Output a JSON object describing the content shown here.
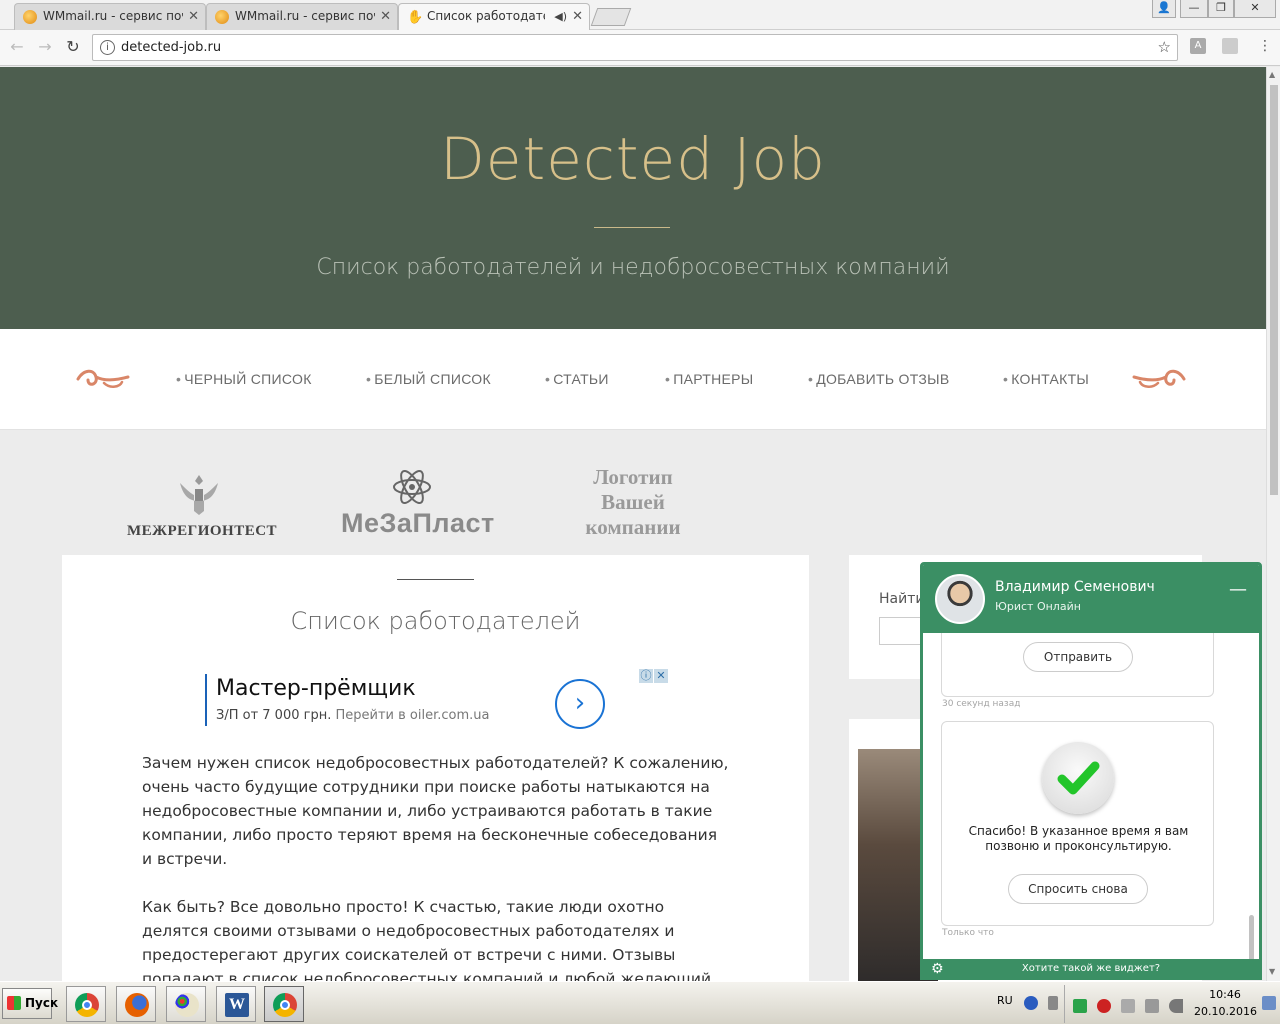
{
  "browser": {
    "tabs": [
      {
        "title": "WMmail.ru - сервис почтов",
        "active": false
      },
      {
        "title": "WMmail.ru - сервис почтов",
        "active": false
      },
      {
        "title": "Список работодателей",
        "active": true
      }
    ],
    "url": "detected-job.ru"
  },
  "hero": {
    "title": "Detected Job",
    "tagline": "Список работодателей и недобросовестных компаний"
  },
  "nav": {
    "items": [
      {
        "label": "ЧЕРНЫЙ СПИСОК"
      },
      {
        "label": "БЕЛЫЙ СПИСОК"
      },
      {
        "label": "СТАТЬИ"
      },
      {
        "label": "ПАРТНЕРЫ"
      },
      {
        "label": "ДОБАВИТЬ ОТЗЫВ"
      },
      {
        "label": "КОНТАКТЫ"
      }
    ]
  },
  "partners": {
    "logo1": "МЕЖРЕГИОНТЕСТ",
    "logo2": "МеЗаПласт",
    "logo3": "Логотип Вашей компании"
  },
  "main": {
    "title": "Список работодателей",
    "ad": {
      "title": "Мастер-прёмщик",
      "salary": "З/П от 7 000 грн.",
      "link": "Перейти в oiler.com.ua"
    },
    "paragraphs": [
      "Зачем нужен список недобросовестных работодателей? К сожалению, очень часто будущие сотрудники при поиске работы натыкаются на недобросовестные компании и, либо устраиваются работать в такие компании, либо просто теряют время на бесконечные собеседования и встречи.",
      "Как быть? Все довольно просто! К счастью, такие люди охотно делятся своими отзывами о недобросовестных работодателях и предостерегают других соискателей от встречи с ними. Отзывы попадают в список недобросовестных компаний и любой желающий может ознакомиться с"
    ]
  },
  "sidebar": {
    "search_label": "Найти"
  },
  "chat": {
    "agent_name": "Владимир Семенович",
    "agent_role": "Юрист Онлайн",
    "send_button": "Отправить",
    "stamp1": "30 секунд назад",
    "thanks_text": "Спасибо! В указанное время я вам позвоню и проконсультирую.",
    "ask_again_button": "Спросить снова",
    "stamp2": "Только что",
    "footer_link": "Хотите такой же виджет?",
    "accent_color": "#3b8f64"
  },
  "taskbar": {
    "start_label": "Пуск",
    "language": "RU",
    "time": "10:46",
    "date": "20.10.2016"
  }
}
